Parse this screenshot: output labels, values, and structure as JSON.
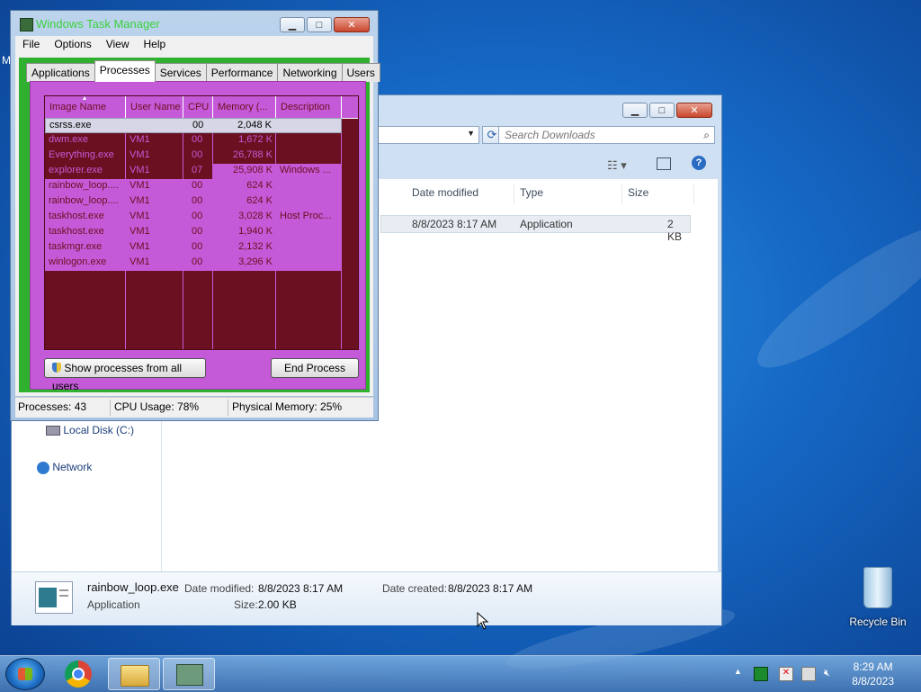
{
  "task_manager": {
    "title": "Windows Task Manager",
    "menu": [
      "File",
      "Options",
      "View",
      "Help"
    ],
    "tabs": [
      "Applications",
      "Processes",
      "Services",
      "Performance",
      "Networking",
      "Users"
    ],
    "active_tab": "Processes",
    "columns": [
      "Image Name",
      "User Name",
      "CPU",
      "Memory (...",
      "Description"
    ],
    "processes": [
      {
        "name": "csrss.exe",
        "user": "",
        "cpu": "00",
        "memory": "2,048 K",
        "description": ""
      },
      {
        "name": "dwm.exe",
        "user": "VM1",
        "cpu": "00",
        "memory": "1,672 K",
        "description": ""
      },
      {
        "name": "Everything.exe",
        "user": "VM1",
        "cpu": "00",
        "memory": "26,788 K",
        "description": ""
      },
      {
        "name": "explorer.exe",
        "user": "VM1",
        "cpu": "07",
        "memory": "25,908 K",
        "description": "Windows ..."
      },
      {
        "name": "rainbow_loop....",
        "user": "VM1",
        "cpu": "00",
        "memory": "624 K",
        "description": ""
      },
      {
        "name": "rainbow_loop....",
        "user": "VM1",
        "cpu": "00",
        "memory": "624 K",
        "description": ""
      },
      {
        "name": "taskhost.exe",
        "user": "VM1",
        "cpu": "00",
        "memory": "3,028 K",
        "description": "Host Proc..."
      },
      {
        "name": "taskhost.exe",
        "user": "VM1",
        "cpu": "00",
        "memory": "1,940 K",
        "description": ""
      },
      {
        "name": "taskmgr.exe",
        "user": "VM1",
        "cpu": "00",
        "memory": "2,132 K",
        "description": ""
      },
      {
        "name": "winlogon.exe",
        "user": "VM1",
        "cpu": "00",
        "memory": "3,296 K",
        "description": ""
      }
    ],
    "show_all_label": "Show processes from all users",
    "end_process_label": "End Process",
    "status": {
      "processes": "Processes: 43",
      "cpu": "CPU Usage: 78%",
      "memory": "Physical Memory: 25%"
    }
  },
  "explorer": {
    "search_placeholder": "Search Downloads",
    "columns": [
      "Date modified",
      "Type",
      "Size"
    ],
    "file_row": {
      "date": "8/8/2023 8:17 AM",
      "type": "Application",
      "size": "2 KB"
    },
    "nav": {
      "local_disk": "Local Disk (C:)",
      "network": "Network"
    },
    "details": {
      "name": "rainbow_loop.exe",
      "type": "Application",
      "date_modified_label": "Date modified:",
      "date_modified": "8/8/2023 8:17 AM",
      "date_created_label": "Date created:",
      "date_created": "8/8/2023 8:17 AM",
      "size_label": "Size:",
      "size": "2.00 KB"
    }
  },
  "desktop": {
    "recycle_bin": "Recycle Bin",
    "clock_time": "8:29 AM",
    "clock_date": "8/8/2023",
    "left_edge_text": "M"
  }
}
